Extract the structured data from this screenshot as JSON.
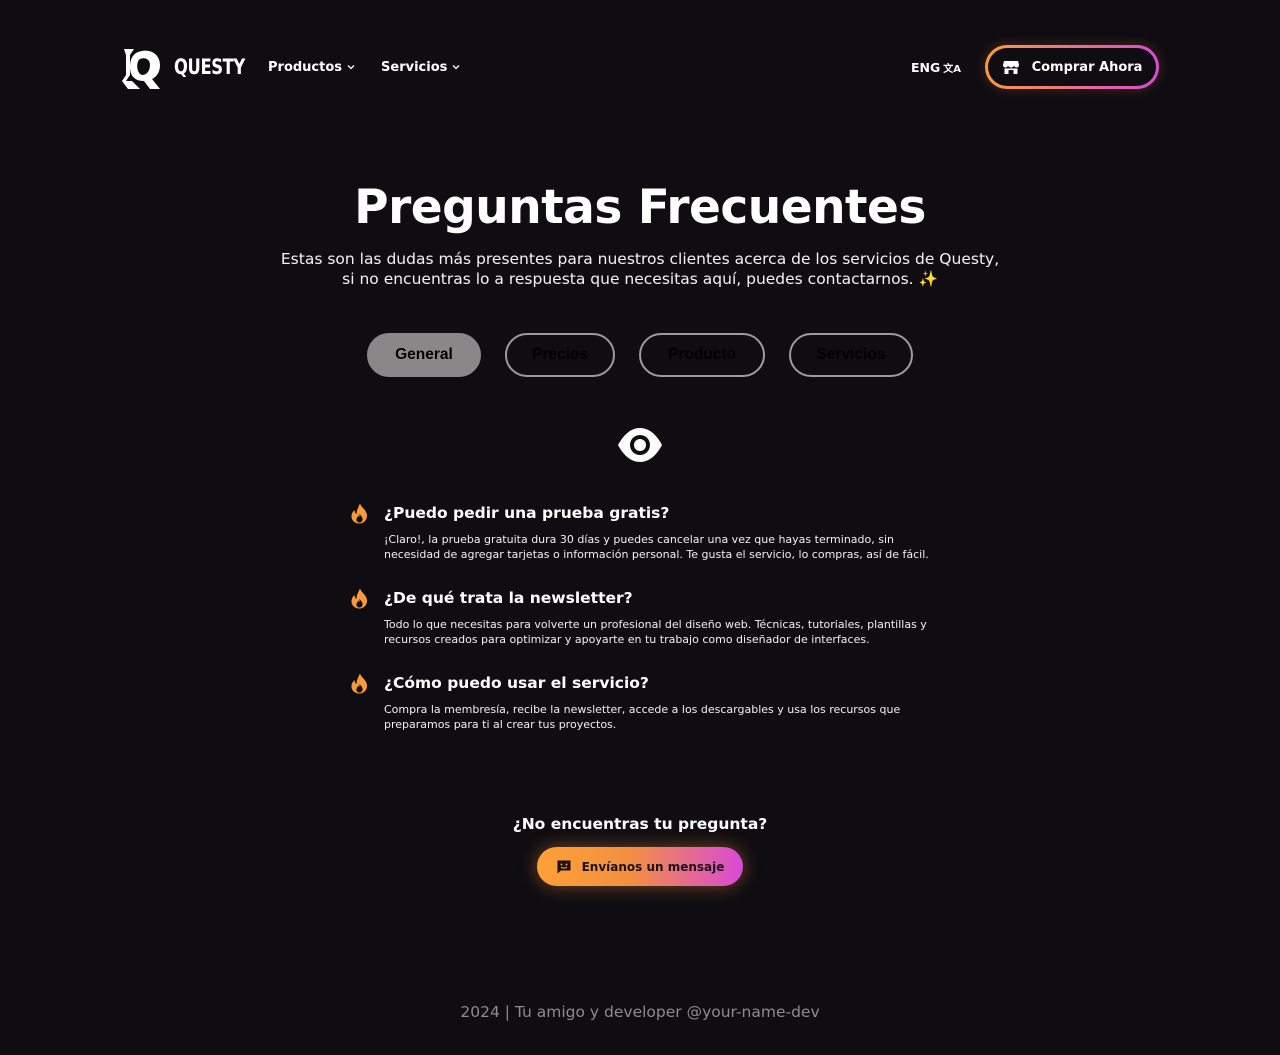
{
  "header": {
    "logo_text": "QUESTY",
    "nav": [
      {
        "label": "Productos"
      },
      {
        "label": "Servicios"
      }
    ],
    "lang_label": "ENG",
    "lang_icon": "translate-icon",
    "buy_label": "Comprar Ahora",
    "buy_icon": "store-icon"
  },
  "hero": {
    "title": "Preguntas Frecuentes",
    "subtitle_line1": "Estas son las dudas más presentes para nuestros clientes acerca de los servicios de Questy,",
    "subtitle_line2": "si no encuentras lo a respuesta que necesitas aquí, puedes contactarnos.",
    "sparkle": "✨"
  },
  "tabs": [
    {
      "label": "General",
      "active": true
    },
    {
      "label": "Precios",
      "active": false
    },
    {
      "label": "Producto",
      "active": false
    },
    {
      "label": "Servicios",
      "active": false
    }
  ],
  "section_icon": "eye-icon",
  "faq": [
    {
      "question": "¿Puedo pedir una prueba gratis?",
      "answer": "¡Claro!, la prueba gratuita dura 30 días y puedes cancelar una vez que hayas terminado, sin necesidad de agregar tarjetas o información personal. Te gusta el servicio, lo compras, así de fácil."
    },
    {
      "question": "¿De qué trata la newsletter?",
      "answer": "Todo lo que necesitas para volverte un profesional del diseño web. Técnicas, tutoriales, plantillas y recursos creados para optimizar y apoyarte en tu trabajo como diseñador de interfaces."
    },
    {
      "question": "¿Cómo puedo usar el servicio?",
      "answer": "Compra la membresía, recibe la newsletter, accede a los descargables y usa los recursos que preparamos para ti al crear tus proyectos."
    }
  ],
  "contact": {
    "question": "¿No encuentras tu pregunta?",
    "button_label": "Envíanos un mensaje",
    "button_icon": "chat-icon"
  },
  "footer": {
    "text": "2024 | Tu amigo y developer @your-name-dev"
  },
  "colors": {
    "background": "#0f0d12",
    "accent_orange": "#fb9b3a",
    "accent_pink": "#d949d6",
    "tab_active": "#8a8789",
    "footer_text": "#8d8b90"
  }
}
